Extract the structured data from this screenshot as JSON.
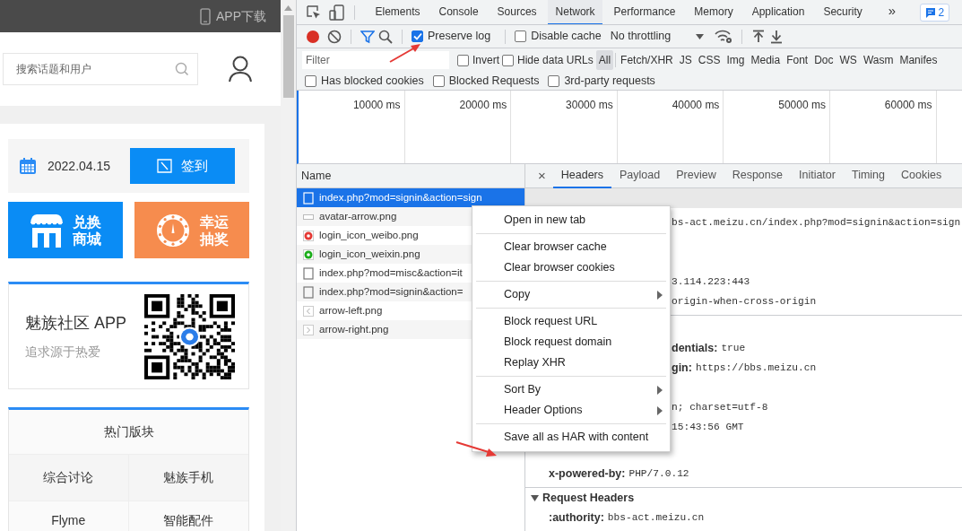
{
  "site": {
    "topbar_link": "APP下载",
    "search": {
      "placeholder": "搜索话题和用户"
    },
    "signin": {
      "date": "2022.04.15",
      "button": "签到"
    },
    "tiles": [
      {
        "kind": "shop",
        "lines": [
          "兑换",
          "商城"
        ],
        "color": "#0a8cf5"
      },
      {
        "kind": "lottery",
        "lines": [
          "幸运",
          "抽奖"
        ],
        "color": "#f68c4e"
      }
    ],
    "app_card": {
      "title": "魅族社区 APP",
      "subtitle": "追求源于热爱"
    },
    "hot": {
      "title": "热门版块",
      "items": [
        "综合讨论",
        "魅族手机",
        "Flyme",
        "智能配件"
      ]
    }
  },
  "devtools": {
    "tabs": [
      {
        "label": "Elements",
        "selected": false
      },
      {
        "label": "Console",
        "selected": false
      },
      {
        "label": "Sources",
        "selected": false
      },
      {
        "label": "Network",
        "selected": true
      },
      {
        "label": "Performance",
        "selected": false
      },
      {
        "label": "Memory",
        "selected": false
      },
      {
        "label": "Application",
        "selected": false
      },
      {
        "label": "Security",
        "selected": false
      }
    ],
    "more": "»",
    "issues": "2",
    "toolbar": {
      "recording": true,
      "preserve_log": {
        "label": "Preserve log",
        "checked": true
      },
      "disable_cache": {
        "label": "Disable cache",
        "checked": false
      },
      "throttling": "No throttling"
    },
    "filter": {
      "placeholder": "Filter",
      "invert": {
        "label": "Invert",
        "checked": false
      },
      "hide_data_urls": {
        "label": "Hide data URLs",
        "checked": false
      },
      "types": [
        {
          "label": "All",
          "selected": true
        },
        {
          "label": "Fetch/XHR",
          "selected": false
        },
        {
          "label": "JS",
          "selected": false
        },
        {
          "label": "CSS",
          "selected": false
        },
        {
          "label": "Img",
          "selected": false
        },
        {
          "label": "Media",
          "selected": false
        },
        {
          "label": "Font",
          "selected": false
        },
        {
          "label": "Doc",
          "selected": false
        },
        {
          "label": "WS",
          "selected": false
        },
        {
          "label": "Wasm",
          "selected": false
        },
        {
          "label": "Manifes",
          "selected": false
        }
      ],
      "more_filters": [
        {
          "label": "Has blocked cookies",
          "checked": false
        },
        {
          "label": "Blocked Requests",
          "checked": false
        },
        {
          "label": "3rd-party requests",
          "checked": false
        }
      ]
    },
    "timeline": [
      "10000 ms",
      "20000 ms",
      "30000 ms",
      "40000 ms",
      "50000 ms",
      "60000 ms"
    ],
    "requests": {
      "column": "Name",
      "rows": [
        {
          "name": "index.php?mod=signin&action=sign",
          "kind": "document",
          "selected": true
        },
        {
          "name": "avatar-arrow.png",
          "kind": "image",
          "selected": false
        },
        {
          "name": "login_icon_weibo.png",
          "kind": "weibo",
          "selected": false
        },
        {
          "name": "login_icon_weixin.png",
          "kind": "weixin",
          "selected": false
        },
        {
          "name": "index.php?mod=misc&action=it",
          "kind": "document",
          "selected": false
        },
        {
          "name": "index.php?mod=signin&action=",
          "kind": "document",
          "selected": false
        },
        {
          "name": "arrow-left.png",
          "kind": "arrow-left",
          "selected": false
        },
        {
          "name": "arrow-right.png",
          "kind": "arrow-right",
          "selected": false
        }
      ]
    },
    "details": {
      "close": "×",
      "tabs": [
        {
          "label": "Headers",
          "selected": true
        },
        {
          "label": "Payload",
          "selected": false
        },
        {
          "label": "Preview",
          "selected": false
        },
        {
          "label": "Response",
          "selected": false
        },
        {
          "label": "Initiator",
          "selected": false
        },
        {
          "label": "Timing",
          "selected": false
        },
        {
          "label": "Cookies",
          "selected": false
        }
      ],
      "general_lines": [
        {
          "value": "bs-act.meizu.cn/index.php?mod=signin&action=sign"
        },
        {
          "value": "3.114.223:443"
        },
        {
          "value": "origin-when-cross-origin"
        }
      ],
      "response_lines": [
        {
          "name": "dentials:",
          "value": "true"
        },
        {
          "name": "gin:",
          "value": "https://bbs.meizu.cn"
        },
        {
          "value": "n; charset=utf-8"
        },
        {
          "value": "15:43:56 GMT"
        },
        {
          "name": "x-powered-by:",
          "value": "PHP/7.0.12"
        }
      ],
      "request_headers": {
        "title": "Request Headers",
        "expanded": true,
        "lines": [
          {
            "name": ":authority:",
            "value": "bbs-act.meizu.cn"
          }
        ]
      }
    },
    "context_menu": [
      {
        "kind": "item",
        "label": "Open in new tab",
        "submenu": false
      },
      {
        "kind": "separator"
      },
      {
        "kind": "item",
        "label": "Clear browser cache",
        "submenu": false
      },
      {
        "kind": "item",
        "label": "Clear browser cookies",
        "submenu": false
      },
      {
        "kind": "separator"
      },
      {
        "kind": "item",
        "label": "Copy",
        "submenu": true
      },
      {
        "kind": "separator"
      },
      {
        "kind": "item",
        "label": "Block request URL",
        "submenu": false
      },
      {
        "kind": "item",
        "label": "Block request domain",
        "submenu": false
      },
      {
        "kind": "item",
        "label": "Replay XHR",
        "submenu": false
      },
      {
        "kind": "separator"
      },
      {
        "kind": "item",
        "label": "Sort By",
        "submenu": true
      },
      {
        "kind": "item",
        "label": "Header Options",
        "submenu": true
      },
      {
        "kind": "separator"
      },
      {
        "kind": "item",
        "label": "Save all as HAR with content",
        "submenu": false
      }
    ]
  }
}
